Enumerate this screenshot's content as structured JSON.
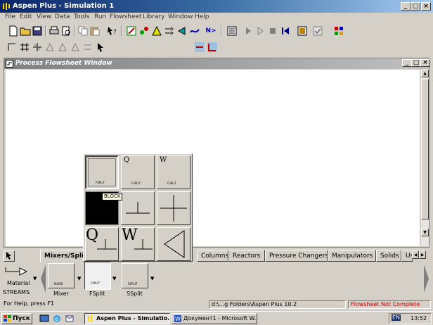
{
  "window": {
    "title": "Aspen Plus - Simulation 1"
  },
  "menu": [
    "File",
    "Edit",
    "View",
    "Data",
    "Tools",
    "Run",
    "Flowsheet",
    "Library",
    "Window",
    "Help"
  ],
  "toolbar": {
    "next_label": "N>"
  },
  "flowsheet_window": {
    "title": "Process Flowsheet Window"
  },
  "popup": {
    "tooltip": "BLOCK",
    "cells": [
      {
        "label": "FSPLIT",
        "letter": ""
      },
      {
        "label": "FSPLIT",
        "letter": "Q"
      },
      {
        "label": "FSPLIT",
        "letter": "W"
      }
    ],
    "big_q": "Q",
    "big_w": "W"
  },
  "palette": {
    "tabs": [
      "Mixers/Splitters",
      "Columns",
      "Reactors",
      "Pressure Changers",
      "Manipulators",
      "Solids",
      "User Models"
    ],
    "streams_label": "STREAMS",
    "material_label": "Material",
    "models": [
      {
        "name": "Mixer",
        "icon_text": "MIXER"
      },
      {
        "name": "FSplit",
        "icon_text": "FSPLIT"
      },
      {
        "name": "SSplit",
        "icon_text": "SSPLIT"
      }
    ]
  },
  "status": {
    "help": "For Help, press F1",
    "path": "d:\\...g Folders\\Aspen Plus 10.2",
    "state": "Flowsheet Not Complete",
    "state_color": "#cc0000"
  },
  "taskbar": {
    "start": "Пуск",
    "tasks": [
      "Aspen Plus - Simulatio...",
      "Документ1 - Microsoft W..."
    ],
    "lang": "EN",
    "clock": "13:52"
  }
}
